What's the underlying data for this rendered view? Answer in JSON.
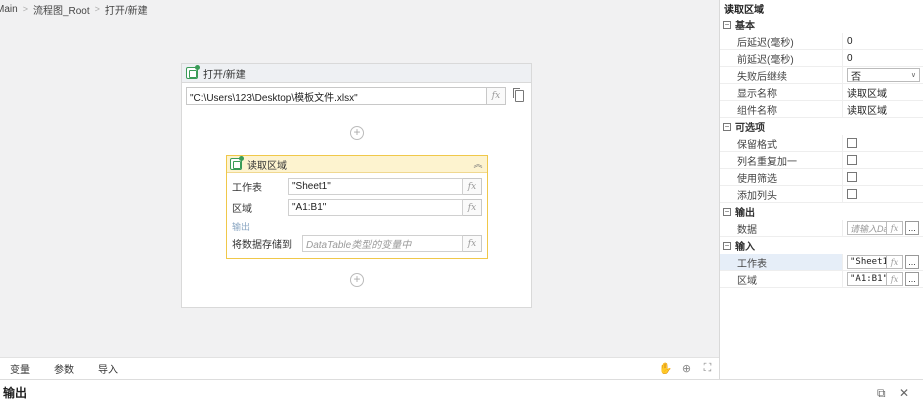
{
  "breadcrumb": [
    "Main",
    "流程图_Root",
    "打开/新建"
  ],
  "open_activity": {
    "title": "打开/新建",
    "path_value": "\"C:\\Users\\123\\Desktop\\模板文件.xlsx\"",
    "fx": "fx"
  },
  "read_activity": {
    "title": "读取区域",
    "rows": [
      {
        "label": "工作表",
        "value": "\"Sheet1\""
      },
      {
        "label": "区域",
        "value": "\"A1:B1\""
      }
    ],
    "output_section": "输出",
    "store_label": "将数据存储到",
    "store_placeholder": "DataTable类型的变量中"
  },
  "bottom_tabs": [
    "变量",
    "参数",
    "导入"
  ],
  "output_panel": {
    "title": "输出"
  },
  "props": {
    "title": "读取区域",
    "basic": {
      "section": "基本",
      "after_delay": {
        "label": "后延迟(毫秒)",
        "value": "0"
      },
      "before_delay": {
        "label": "前延迟(毫秒)",
        "value": "0"
      },
      "continue_on_fail": {
        "label": "失败后继续",
        "value": "否"
      },
      "display_name": {
        "label": "显示名称",
        "value": "读取区域"
      },
      "component_name": {
        "label": "组件名称",
        "value": "读取区域"
      }
    },
    "optional": {
      "section": "可选项",
      "items": [
        "保留格式",
        "列名重复加一",
        "使用筛选",
        "添加列头"
      ]
    },
    "output": {
      "section": "输出",
      "data": {
        "label": "数据",
        "placeholder": "请输入Da"
      }
    },
    "input": {
      "section": "输入",
      "sheet": {
        "label": "工作表",
        "value": "\"Sheet1\""
      },
      "range": {
        "label": "区域",
        "value": "\"A1:B1\""
      }
    }
  }
}
